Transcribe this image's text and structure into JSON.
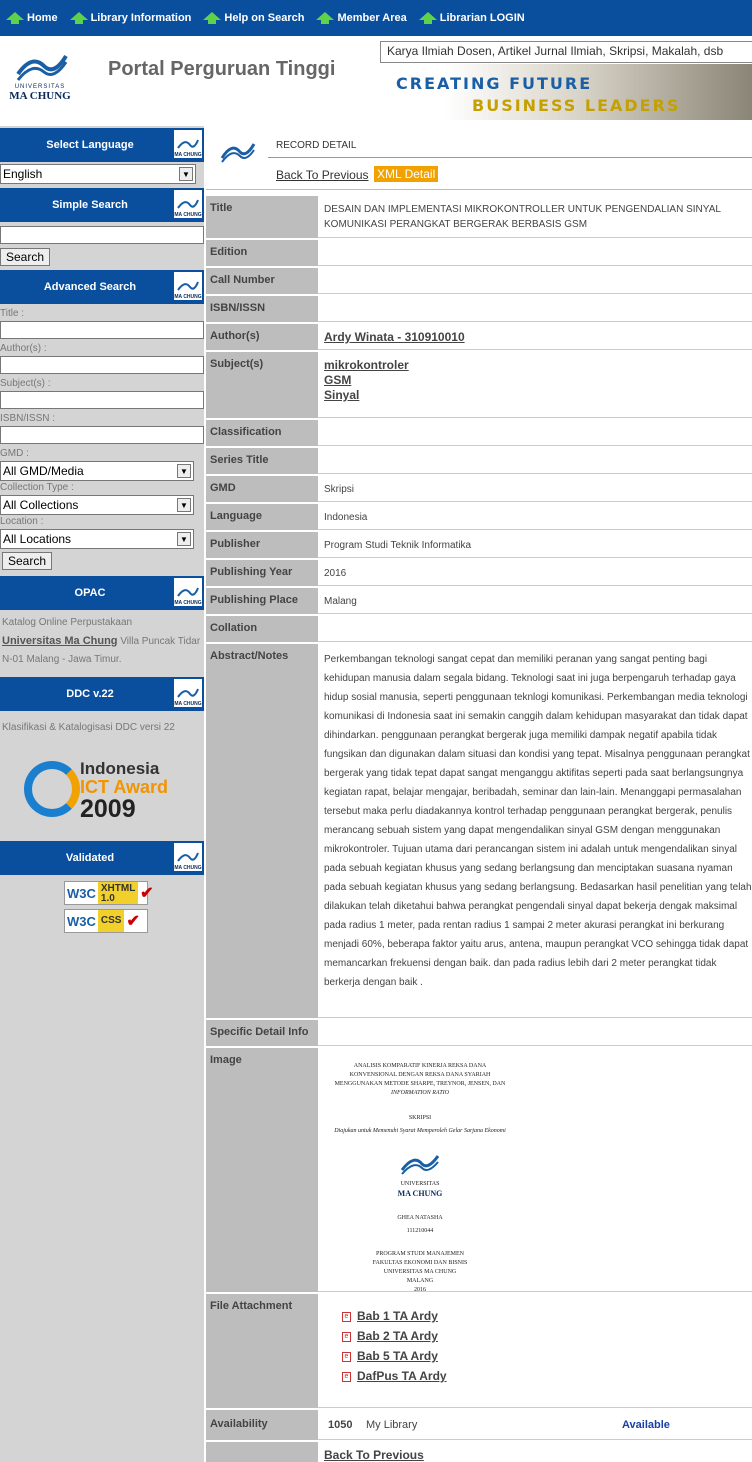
{
  "topnav": {
    "items": [
      "Home",
      "Library Information",
      "Help on Search",
      "Member Area",
      "Librarian LOGIN"
    ]
  },
  "header": {
    "logo_university": "UNIVERSITAS",
    "logo_name": "MA CHUNG",
    "portal_title": "Portal Perguruan Tinggi",
    "marquee_text": "Karya Ilmiah Dosen, Artikel Jurnal Ilmiah, Skripsi, Makalah, dsb",
    "banner_line1": "CREATING FUTURE",
    "banner_line2": "BUSINESS LEADERS"
  },
  "sidebar": {
    "logo_small": "MA CHUNG",
    "language": {
      "title": "Select Language",
      "selected": "English"
    },
    "simple_search": {
      "title": "Simple Search",
      "button": "Search"
    },
    "advanced": {
      "title": "Advanced Search",
      "labels": {
        "title": "Title :",
        "author": "Author(s) :",
        "subject": "Subject(s) :",
        "isbn": "ISBN/ISSN :",
        "gmd": "GMD :",
        "collection": "Collection Type :",
        "location": "Location :"
      },
      "gmd_selected": "All GMD/Media",
      "collection_selected": "All Collections",
      "location_selected": "All Locations",
      "button": "Search"
    },
    "opac": {
      "title": "OPAC",
      "text1": "Katalog Online Perpustakaan",
      "link": "Universitas Ma Chung",
      "text2": "Villa Puncak Tidar N-01 Malang - Jawa Timur."
    },
    "ddc": {
      "title": "DDC v.22",
      "text": "Klasifikasi & Katalogisasi DDC versi 22"
    },
    "award": {
      "line1": "Indonesia",
      "line2": "ICT Award",
      "line3": "2009"
    },
    "validated": {
      "title": "Validated",
      "badge1": "XHTML 1.0",
      "badge2": "CSS",
      "w3c": "W3C"
    }
  },
  "record": {
    "header_title": "RECORD DETAIL",
    "back_label": "Back To Previous",
    "xml_label": "XML Detail",
    "fields": {
      "title_k": "Title",
      "title_v": "DESAIN DAN IMPLEMENTASI MIKROKONTROLLER UNTUK PENGENDALIAN SINYAL KOMUNIKASI PERANGKAT BERGERAK BERBASIS GSM",
      "edition_k": "Edition",
      "call_k": "Call Number",
      "isbn_k": "ISBN/ISSN",
      "author_k": "Author(s)",
      "author_v": "Ardy Winata - 310910010",
      "subject_k": "Subject(s)",
      "subjects": [
        "mikrokontroler",
        "GSM",
        "Sinyal"
      ],
      "class_k": "Classification",
      "series_k": "Series Title",
      "gmd_k": "GMD",
      "gmd_v": "Skripsi",
      "lang_k": "Language",
      "lang_v": "Indonesia",
      "pub_k": "Publisher",
      "pub_v": "Program Studi Teknik Informatika",
      "year_k": "Publishing Year",
      "year_v": "2016",
      "place_k": "Publishing Place",
      "place_v": "Malang",
      "coll_k": "Collation",
      "abs_k": "Abstract/Notes",
      "abs_v": "Perkembangan teknologi sangat cepat dan memiliki peranan yang sangat penting bagi kehidupan manusia dalam segala bidang. Teknologi saat ini juga berpengaruh terhadap gaya hidup sosial manusia, seperti penggunaan teknlogi komunikasi. Perkembangan media teknologi komunikasi di Indonesia saat ini semakin canggih dalam kehidupan masyarakat dan tidak dapat dihindarkan. penggunaan perangkat bergerak juga memiliki dampak negatif apabila tidak fungsikan dan digunakan dalam situasi dan kondisi yang tepat. Misalnya penggunaan perangkat bergerak yang tidak tepat dapat sangat menganggu aktifitas seperti pada saat berlangsungnya kegiatan rapat, belajar mengajar, beribadah, seminar dan lain-lain. Menanggapi permasalahan tersebut maka perlu diadakannya kontrol terhadap penggunaan perangkat bergerak, penulis merancang sebuah sistem yang dapat mengendalikan sinyal GSM dengan menggunakan mikrokontroler. Tujuan utama dari perancangan sistem ini adalah untuk mengendalikan sinyal pada sebuah kegiatan khusus yang sedang berlangsung dan menciptakan suasana nyaman pada sebuah kegiatan khusus yang sedang berlangsung. Bedasarkan hasil penelitian yang telah dilakukan telah diketahui bahwa perangkat pengendali sinyal dapat bekerja dengak maksimal pada radius 1 meter, pada rentan radius 1 sampai 2 meter akurasi perangkat ini berkurang menjadi 60%, beberapa faktor yaitu arus, antena, maupun perangkat VCO sehingga tidak dapat memancarkan frekuensi dengan baik. dan pada radius lebih dari 2 meter perangkat tidak berkerja dengan baik .",
      "spec_k": "Specific Detail Info",
      "image_k": "Image",
      "files_k": "File Attachment",
      "files": [
        "Bab 1 TA Ardy",
        "Bab 2 TA Ardy",
        "Bab 5 TA Ardy",
        "DafPus TA Ardy"
      ],
      "avail_k": "Availability",
      "avail_code": "1050",
      "avail_loc": "My Library",
      "avail_status": "Available"
    },
    "cover": {
      "l1": "ANALISIS KOMPARATIF KINERJA REKSA DANA",
      "l2": "KONVENSIONAL DENGAN REKSA DANA SYARIAH",
      "l3": "MENGGUNAKAN METODE SHARPE, TREYNOR, JENSEN, DAN",
      "l4": "INFORMATION RATIO",
      "l5": "SKRIPSI",
      "l6": "Diajukan untuk Memenuhi Syarat Memperoleh Gelar Sarjana Ekonomi",
      "l7": "UNIVERSITAS",
      "l8": "MA CHUNG",
      "l9": "GHEA NATASHA",
      "l10": "111210044",
      "l11": "PROGRAM STUDI MANAJEMEN",
      "l12": "FAKULTAS EKONOMI DAN BISNIS",
      "l13": "UNIVERSITAS MA CHUNG",
      "l14": "MALANG",
      "l15": "2016"
    }
  },
  "colors": {
    "nav_blue": "#0a4f9e",
    "accent_orange": "#f2a200",
    "sidebar_gray": "#d4d4d4",
    "label_gray": "#bdbdbd"
  }
}
